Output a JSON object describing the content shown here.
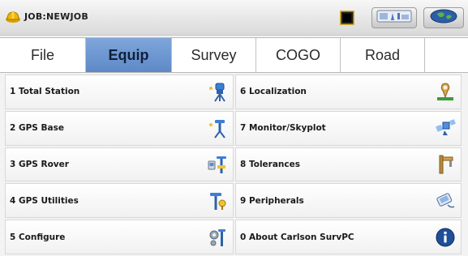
{
  "title_bar": {
    "job_label": "JOB:NEWJOB",
    "icons": [
      "hardhat-icon",
      "battery-icon",
      "status-bar-icon",
      "globe-icon"
    ]
  },
  "tabs": [
    {
      "label": "File",
      "active": false
    },
    {
      "label": "Equip",
      "active": true
    },
    {
      "label": "Survey",
      "active": false
    },
    {
      "label": "COGO",
      "active": false
    },
    {
      "label": "Road",
      "active": false
    }
  ],
  "menu": {
    "left": [
      {
        "label": "1 Total Station",
        "icon": "total-station-icon"
      },
      {
        "label": "2 GPS Base",
        "icon": "gps-base-icon"
      },
      {
        "label": "3 GPS Rover",
        "icon": "gps-rover-icon"
      },
      {
        "label": "4 GPS Utilities",
        "icon": "gps-utilities-icon"
      },
      {
        "label": "5 Configure",
        "icon": "configure-icon"
      }
    ],
    "right": [
      {
        "label": "6 Localization",
        "icon": "localization-icon"
      },
      {
        "label": "7 Monitor/Skyplot",
        "icon": "satellite-icon"
      },
      {
        "label": "8 Tolerances",
        "icon": "tolerances-icon"
      },
      {
        "label": "9 Peripherals",
        "icon": "peripherals-icon"
      },
      {
        "label": "0 About Carlson SurvPC",
        "icon": "info-icon"
      }
    ]
  },
  "colors": {
    "active_tab": "#6a94cf",
    "title_bar": "#e0e0e0",
    "item_bg": "#ffffff"
  }
}
